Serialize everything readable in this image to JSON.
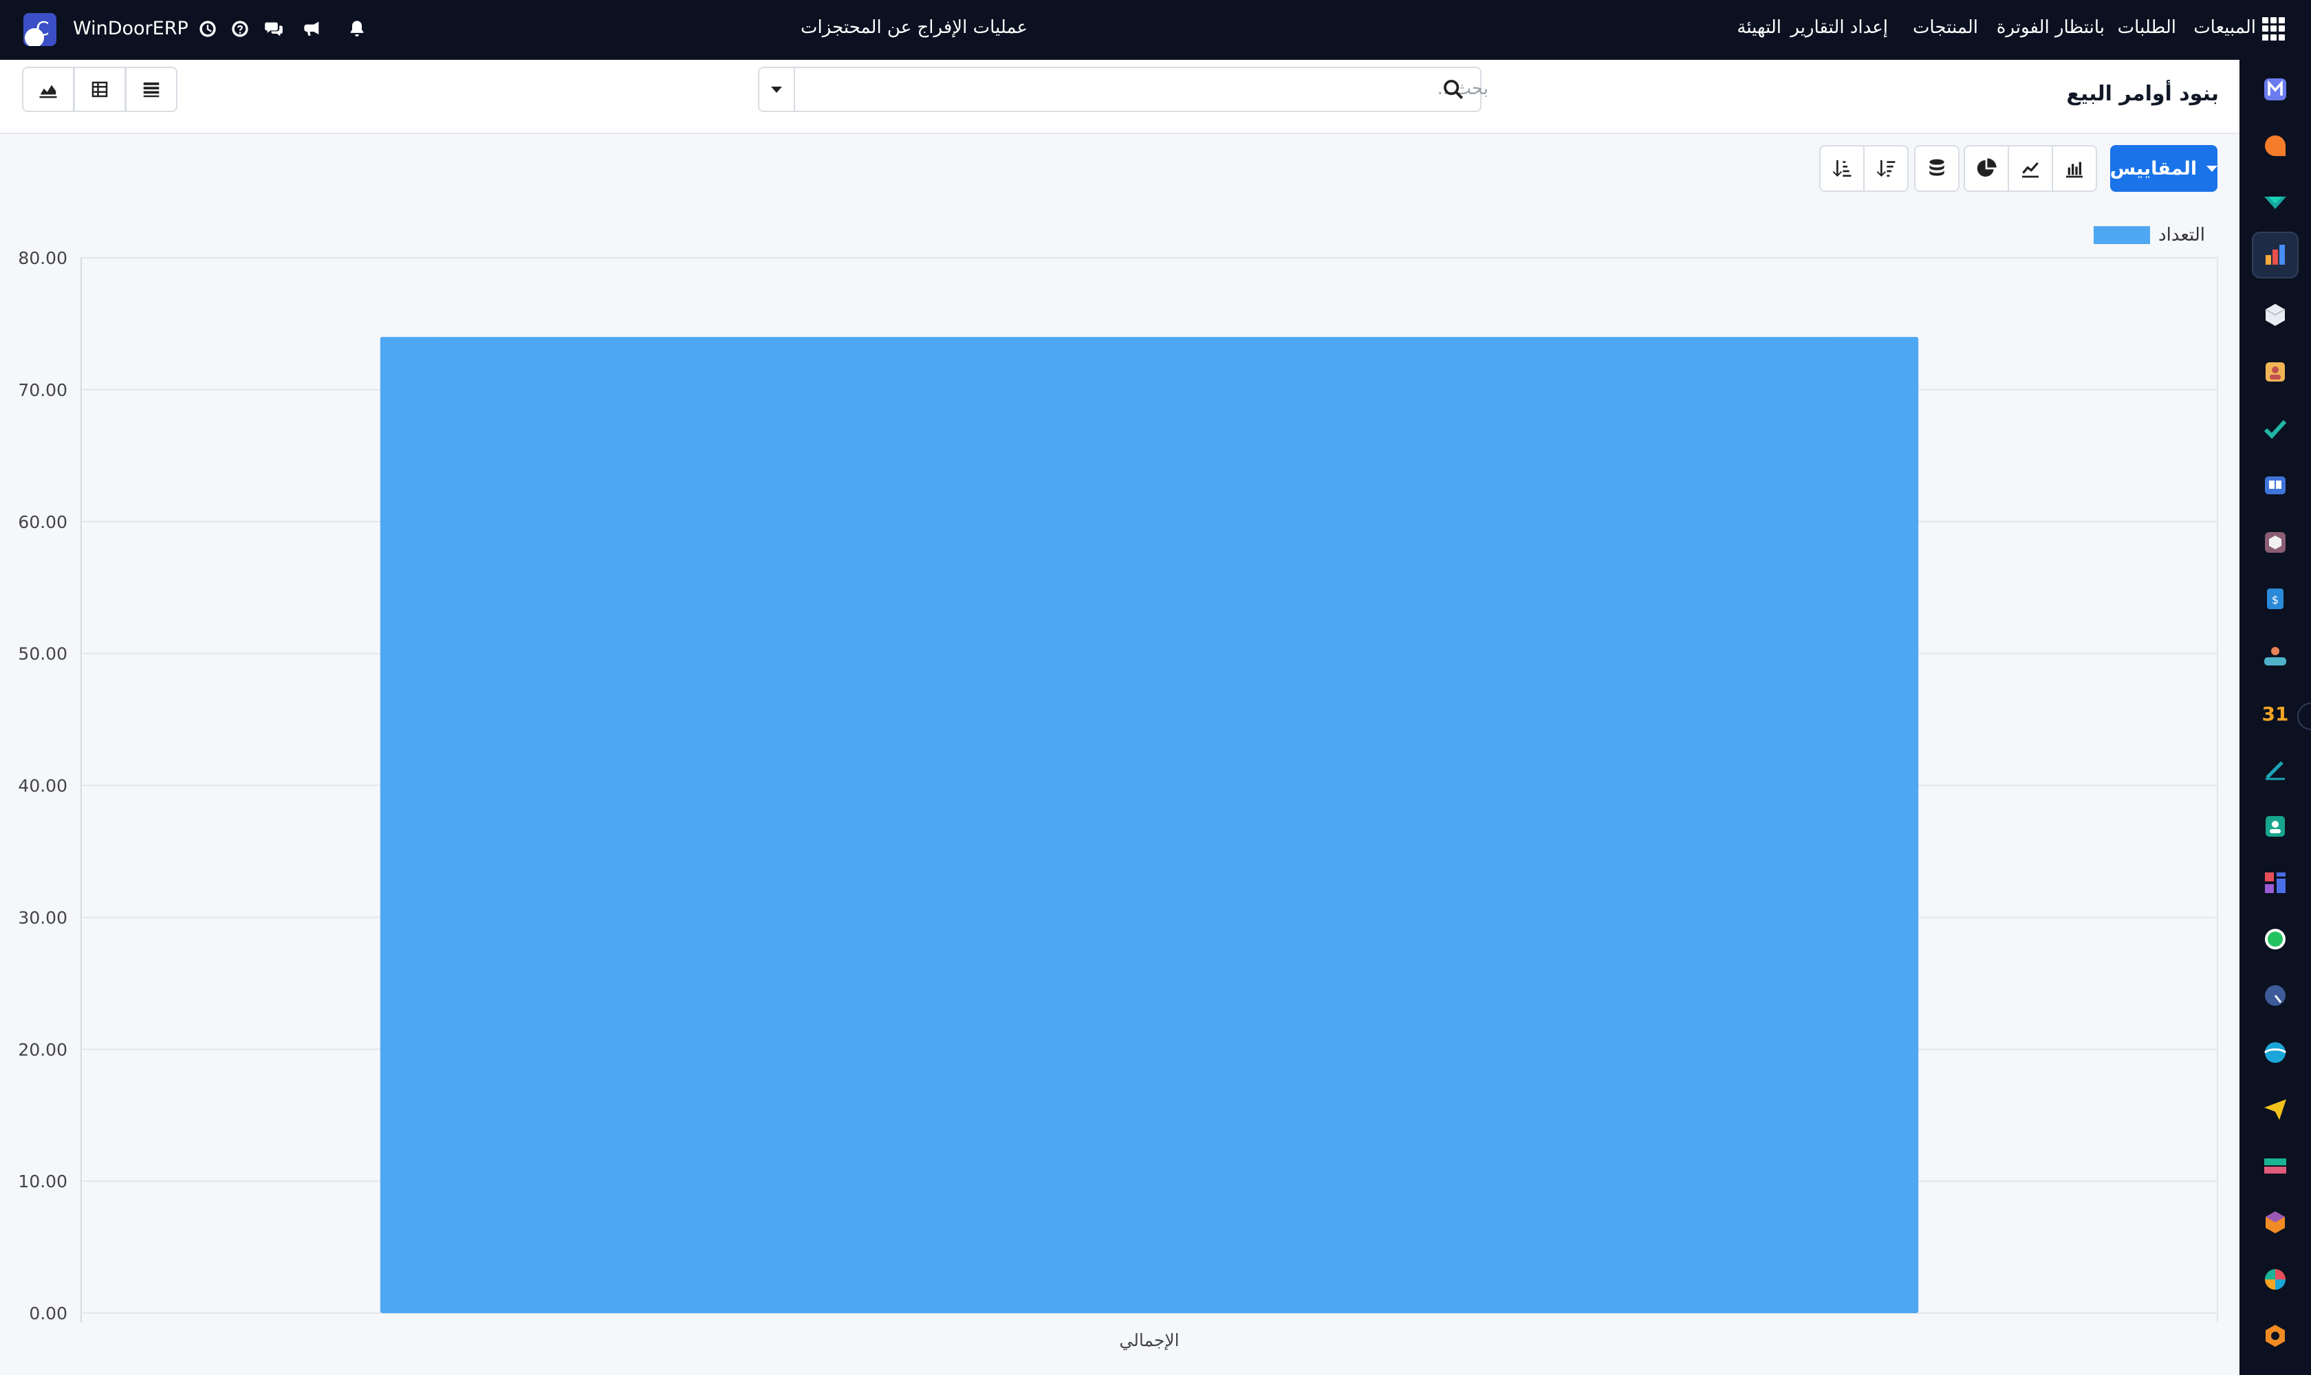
{
  "navbar": {
    "brand_name": "WinDoorERP",
    "brand_letter": "C",
    "menu": [
      {
        "label": "المبيعات",
        "key": "sales"
      },
      {
        "label": "الطلبات",
        "key": "orders"
      },
      {
        "label": "بانتظار الفوترة",
        "key": "to-invoice"
      },
      {
        "label": "المنتجات",
        "key": "products"
      },
      {
        "label": "إعداد التقارير",
        "key": "reporting"
      },
      {
        "label": "التهيئة",
        "key": "configuration"
      },
      {
        "label": "عمليات الإفراج عن المحتجزات",
        "key": "retention-releases"
      }
    ],
    "icons": [
      "apps-grid-icon",
      "bell-icon",
      "bullhorn-icon",
      "chat-icon",
      "help-icon",
      "clock-icon"
    ]
  },
  "control_panel": {
    "title": "بنود أوامر البيع",
    "search_placeholder": "بحث..."
  },
  "toolbar": {
    "measures_label": "المقاييس",
    "buttons": [
      "bar-chart-icon",
      "line-chart-icon",
      "pie-chart-icon",
      "stacked-icon",
      "sort-descending-icon",
      "sort-ascending-icon"
    ]
  },
  "views": [
    "list-view-icon",
    "pivot-view-icon",
    "graph-view-icon"
  ],
  "apps_sidebar": [
    "sales-app",
    "discuss-app",
    "inventory-app",
    "reporting-app",
    "products-app",
    "contacts-app",
    "tasks-app",
    "knowledge-app",
    "packages-app",
    "invoicing-app",
    "employees-app",
    "calendar-app",
    "sign-app",
    "directory-app",
    "dashboard-app",
    "whatsapp-app",
    "timesheet-app",
    "website-app",
    "email-marketing-app",
    "payroll-app",
    "modules-app",
    "survey-app",
    "settings-app"
  ],
  "chart_data": {
    "type": "bar",
    "categories": [
      "الإجمالي"
    ],
    "series": [
      {
        "name": "التعداد",
        "values": [
          74
        ]
      }
    ],
    "ylim": [
      0,
      80
    ],
    "yticks": [
      "0.00",
      "10.00",
      "20.00",
      "30.00",
      "40.00",
      "50.00",
      "60.00",
      "70.00",
      "80.00"
    ],
    "grid": true,
    "legend_position": "top-right",
    "bar_color": "#4ea7f2"
  }
}
